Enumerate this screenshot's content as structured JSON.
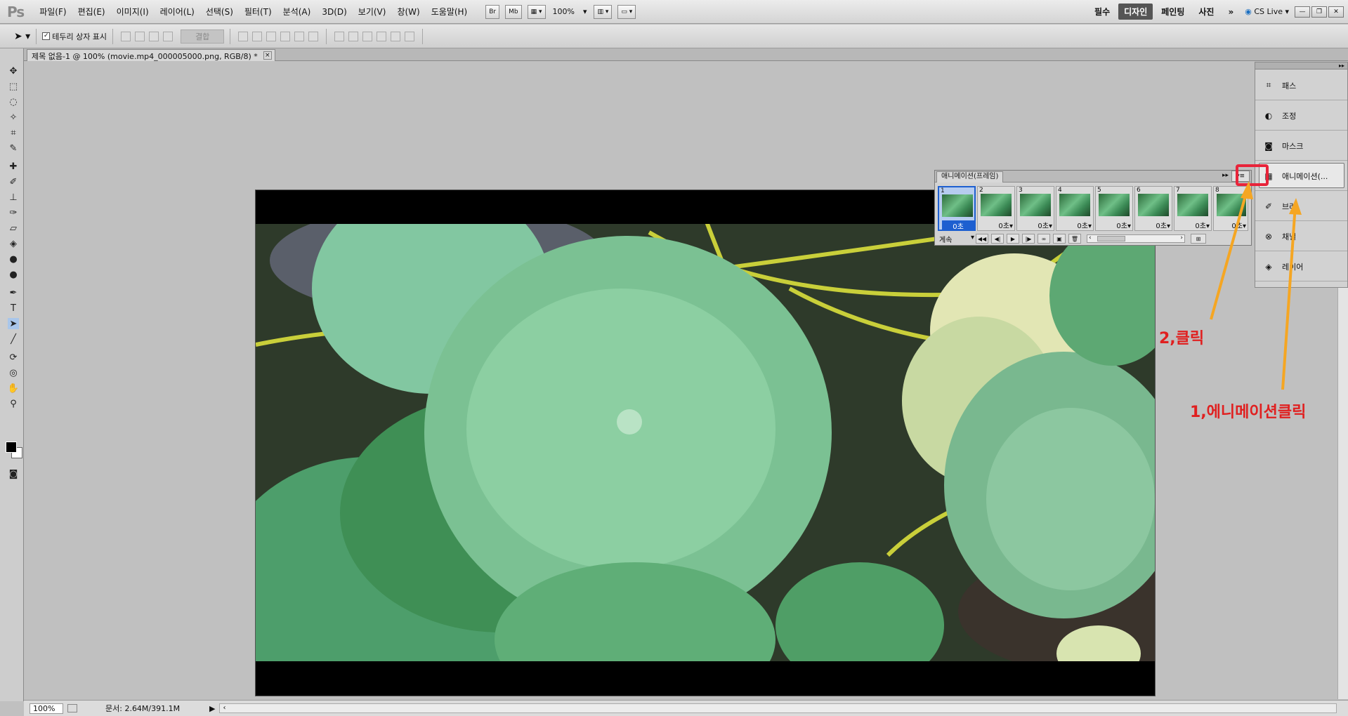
{
  "app": {
    "logo": "Ps"
  },
  "menu": [
    "파일(F)",
    "편집(E)",
    "이미지(I)",
    "레이어(L)",
    "선택(S)",
    "필터(T)",
    "분석(A)",
    "3D(D)",
    "보기(V)",
    "창(W)",
    "도움말(H)"
  ],
  "toolbar": {
    "bridge": "Br",
    "minibridge": "Mb",
    "zoom": "100%"
  },
  "workspace": {
    "items": [
      "필수",
      "디자인",
      "페인팅",
      "사진"
    ],
    "active": "디자인",
    "more": "»",
    "cslive": "CS Live"
  },
  "options": {
    "show_transform": "테두리 상자 표시",
    "combine": "결합"
  },
  "document": {
    "tab_title": "제목 없음-1 @ 100% (movie.mp4_000005000.png, RGB/8) *",
    "close": "×"
  },
  "statusbar": {
    "zoom": "100%",
    "doc_info": "문서: 2.64M/391.1M"
  },
  "right_panel": {
    "items": [
      {
        "label": "패스",
        "icon": "path-icon"
      },
      {
        "label": "조정",
        "icon": "adjust-icon"
      },
      {
        "label": "마스크",
        "icon": "mask-icon"
      },
      {
        "label": "애니메이션(...",
        "icon": "animation-icon"
      },
      {
        "label": "브러",
        "icon": "brush-icon"
      },
      {
        "label": "채널",
        "icon": "channel-icon"
      },
      {
        "label": "레이어",
        "icon": "layers-icon"
      }
    ]
  },
  "animation_panel": {
    "title": "애니메이션(프레임)",
    "frames": [
      {
        "num": "1",
        "time": "0초",
        "selected": true
      },
      {
        "num": "2",
        "time": "0초▾"
      },
      {
        "num": "3",
        "time": "0초▾"
      },
      {
        "num": "4",
        "time": "0초▾"
      },
      {
        "num": "5",
        "time": "0초▾"
      },
      {
        "num": "6",
        "time": "0초▾"
      },
      {
        "num": "7",
        "time": "0초▾"
      },
      {
        "num": "8",
        "time": "0초▾"
      }
    ],
    "loop": "계속"
  },
  "annotations": {
    "click2": "2,클릭",
    "click1": "1,에니메이션클릭"
  },
  "colors": {
    "accent_red": "#e02020",
    "selection_blue": "#1d5fd0",
    "arrow_orange": "#f5a623"
  }
}
